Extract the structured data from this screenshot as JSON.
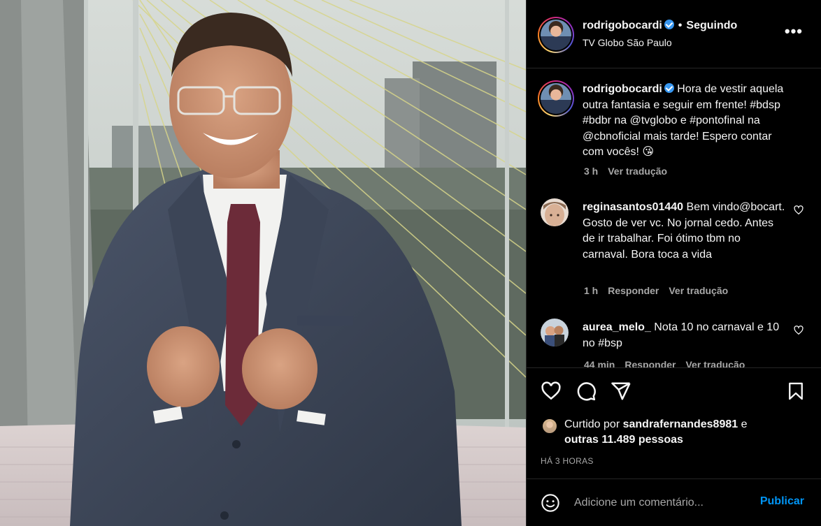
{
  "post": {
    "username": "rodrigobocardi",
    "follow_status": "Seguindo",
    "location": "TV Globo São Paulo",
    "caption": {
      "username": "rodrigobocardi",
      "text": "Hora de vestir aquela outra fantasia e seguir em frente! #bdsp #bdbr na @tvglobo e #pontofinal na @cbnoficial mais tarde! Espero contar com vocês! 😘",
      "time": "3 h",
      "translate": "Ver tradução"
    }
  },
  "comments": [
    {
      "username": "reginasantos01440",
      "text": "Bem vindo@bocart. Gosto de ver vc. No jornal cedo. Antes de ir trabalhar. Foi ótimo tbm no carnaval. Bora toca a vida",
      "time": "1 h",
      "reply": "Responder",
      "translate": "Ver tradução"
    },
    {
      "username": "aurea_melo_",
      "text": "Nota 10 no carnaval e 10 no #bsp",
      "time": "44 min",
      "reply": "Responder",
      "translate": "Ver tradução"
    }
  ],
  "likes": {
    "prefix": "Curtido por",
    "user": "sandrafernandes8981",
    "joiner": "e",
    "others": "outras 11.489 pessoas"
  },
  "timestamp": "HÁ 3 HORAS",
  "add_comment": {
    "placeholder": "Adicione um comentário...",
    "publish_label": "Publicar"
  },
  "icons": {
    "more": "more-options-icon",
    "like": "heart-icon",
    "comment": "comment-icon",
    "share": "share-icon",
    "save": "bookmark-icon",
    "emoji": "emoji-icon"
  },
  "colors": {
    "background": "#000000",
    "text": "#f5f5f5",
    "muted": "#a8a8a8",
    "link": "#0095f6",
    "verified": "#3897f0",
    "divider": "#262626"
  }
}
